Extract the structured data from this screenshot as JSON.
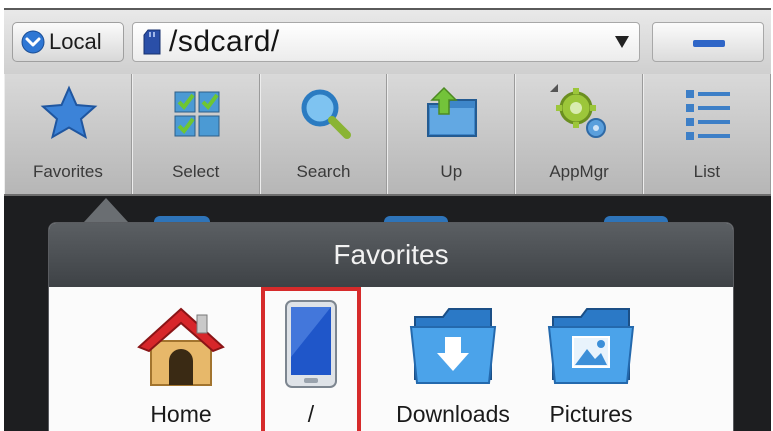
{
  "address_bar": {
    "location_label": "Local",
    "path": "/sdcard/"
  },
  "toolbar": {
    "items": [
      {
        "label": "Favorites",
        "icon": "star-icon"
      },
      {
        "label": "Select",
        "icon": "select-grid-icon"
      },
      {
        "label": "Search",
        "icon": "magnifier-icon"
      },
      {
        "label": "Up",
        "icon": "folder-up-icon"
      },
      {
        "label": "AppMgr",
        "icon": "gear-icon"
      },
      {
        "label": "List",
        "icon": "list-icon"
      }
    ]
  },
  "favorites_panel": {
    "title": "Favorites",
    "items": [
      {
        "label": "Home",
        "icon": "house-icon"
      },
      {
        "label": "/",
        "icon": "phone-icon",
        "selected": true
      },
      {
        "label": "Downloads",
        "icon": "download-folder-icon"
      },
      {
        "label": "Pictures",
        "icon": "pictures-folder-icon"
      }
    ]
  },
  "colors": {
    "selection": "#d62b2b",
    "accent": "#2f66c7",
    "panel_header": "#4a4e52"
  }
}
